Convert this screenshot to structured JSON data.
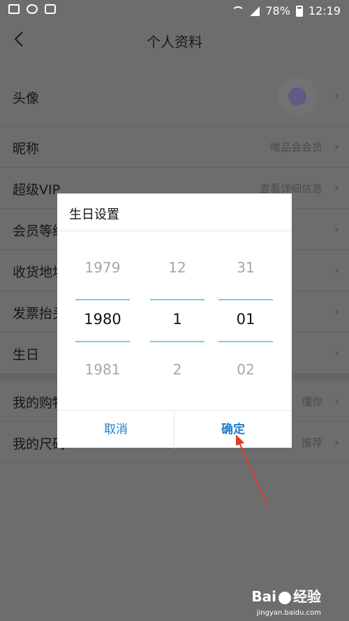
{
  "status_bar": {
    "battery": "78%",
    "time": "12:19"
  },
  "header": {
    "title": "个人资料"
  },
  "profile_rows": [
    {
      "label": "头像",
      "value": ""
    },
    {
      "label": "昵称",
      "value": "唯品会会员"
    },
    {
      "label": "超级VIP",
      "value": "查看详细信息"
    },
    {
      "label": "会员等级",
      "value": ""
    },
    {
      "label": "收货地址",
      "value": ""
    },
    {
      "label": "发票抬头",
      "value": ""
    },
    {
      "label": "生日",
      "value": ""
    },
    {
      "label": "我的购物",
      "value": "懂你"
    },
    {
      "label": "我的尺码",
      "value": "推荐"
    }
  ],
  "dialog": {
    "title": "生日设置",
    "year": {
      "prev": "1979",
      "current": "1980",
      "next": "1981"
    },
    "month": {
      "prev": "12",
      "current": "1",
      "next": "2"
    },
    "day": {
      "prev": "31",
      "current": "01",
      "next": "02"
    },
    "cancel_label": "取消",
    "confirm_label": "确定"
  },
  "colors": {
    "accent": "#1d7dc9",
    "picker_line": "#7ecbe3",
    "overlay": "#6d6d6d",
    "arrow": "#e23a2e"
  },
  "icons": {
    "status_left": [
      "image-icon",
      "account-icon",
      "message-icon"
    ],
    "status_right": [
      "wifi-icon",
      "signal-icon",
      "battery-icon"
    ],
    "back": "back-chevron-icon",
    "row_chevron": "chevron-right-icon"
  },
  "watermark": {
    "brand_a": "Bai",
    "brand_b": "经验",
    "url": "jingyan.baidu.com"
  }
}
